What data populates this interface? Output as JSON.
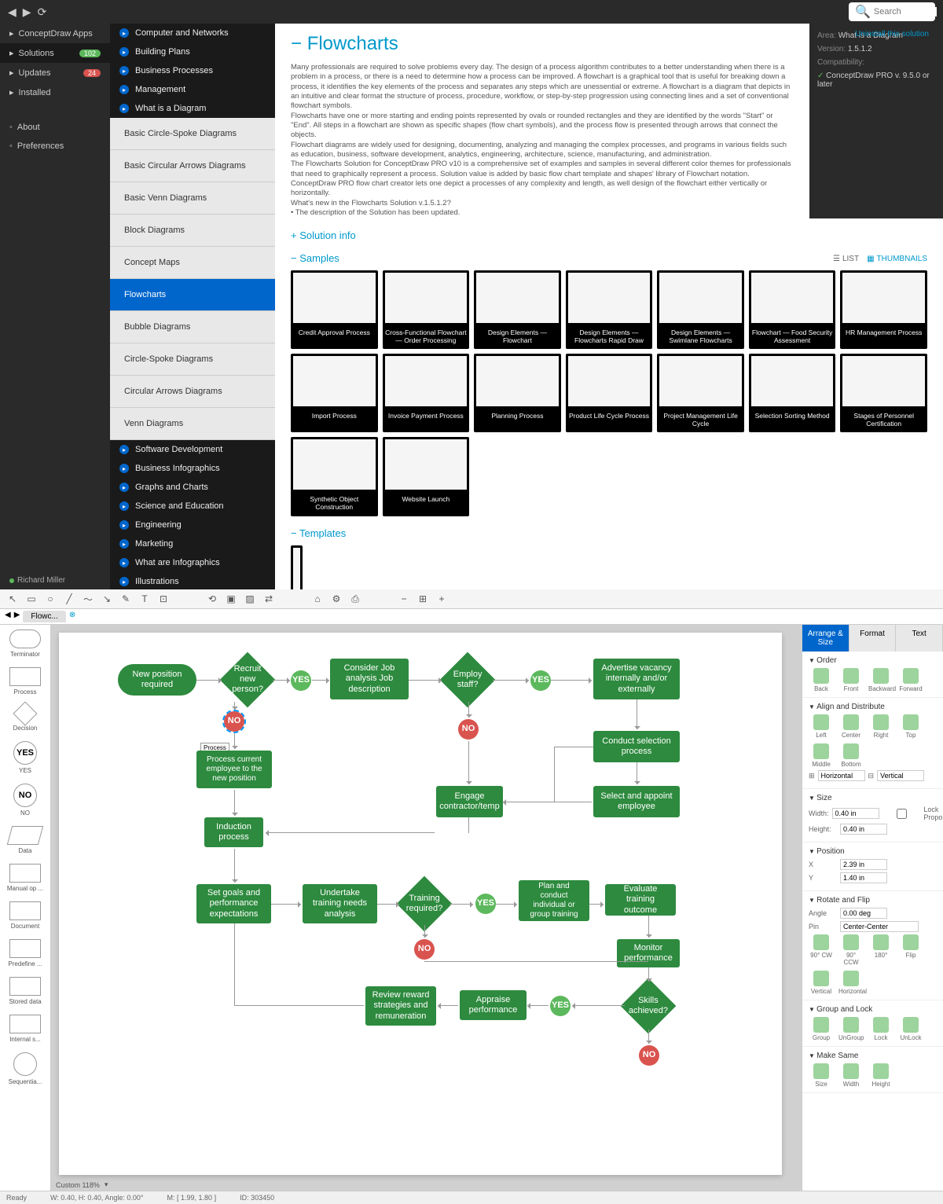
{
  "topbar": {
    "search_placeholder": "Search"
  },
  "leftNav": {
    "items": [
      {
        "label": "ConceptDraw Apps",
        "icon": "apps"
      },
      {
        "label": "Solutions",
        "icon": "cart",
        "badge": "102",
        "badge_color": "green",
        "active": true
      },
      {
        "label": "Updates",
        "icon": "download",
        "badge": "24",
        "badge_color": "red"
      },
      {
        "label": "Installed",
        "icon": "check"
      }
    ],
    "footerItems": [
      {
        "label": "About",
        "icon": "info"
      },
      {
        "label": "Preferences",
        "icon": "gear"
      }
    ],
    "user": "Richard Miller"
  },
  "categories": {
    "top": [
      "Computer and Networks",
      "Building Plans",
      "Business Processes",
      "Management",
      "What is a Diagram"
    ],
    "sub": [
      "Basic Circle-Spoke Diagrams",
      "Basic Circular Arrows Diagrams",
      "Basic Venn Diagrams",
      "Block Diagrams",
      "Concept Maps",
      "Flowcharts",
      "Bubble Diagrams",
      "Circle-Spoke Diagrams",
      "Circular Arrows Diagrams",
      "Venn Diagrams"
    ],
    "selected": "Flowcharts",
    "bottom": [
      "Software Development",
      "Business Infographics",
      "Graphs and Charts",
      "Science and Education",
      "Engineering",
      "Marketing",
      "What are Infographics",
      "Illustrations"
    ]
  },
  "main": {
    "uninstall": "Uninstall this solution",
    "title": "Flowcharts",
    "description": "Many professionals are required to solve problems every day. The design of a process algorithm contributes to a better understanding when there is a problem in a process, or there is a need to determine how a process can be improved. A flowchart is a graphical tool that is useful for breaking down a process, it identifies the key elements of the process and separates any steps which are unessential or extreme. A flowchart is a diagram that depicts in an intuitive and clear format the structure of process, procedure, workflow, or step-by-step progression using connecting lines and a set of conventional flowchart symbols.\nFlowcharts have one or more starting and ending points represented by ovals or rounded rectangles and they are identified by the words \"Start\" or \"End\". All steps in a flowchart are shown as specific shapes (flow chart symbols), and the process flow is presented through arrows that connect the objects.\nFlowchart diagrams are widely used for designing, documenting, analyzing and managing the complex processes, and programs in various fields such as education, business, software development, analytics, engineering, architecture, science, manufacturing, and administration.\nThe Flowcharts Solution for ConceptDraw PRO v10 is a comprehensive set of examples and samples in several different color themes for professionals that need to graphically represent a process. Solution value is added by basic flow chart template and shapes' library of Flowchart notation. ConceptDraw PRO flow chart creator lets one depict a processes of any complexity and length, as well design of the flowchart either vertically or horizontally.\nWhat's new in the Flowcharts Solution v.1.5.1.2?\n  • The description of the Solution has been updated.",
    "meta": {
      "area_label": "Area:",
      "area": "What is a Diagram",
      "version_label": "Version:",
      "version": "1.5.1.2",
      "compat_label": "Compatibility:",
      "compat": "ConceptDraw PRO v. 9.5.0 or later"
    },
    "sections": {
      "info": "Solution info",
      "samples": "Samples",
      "templates": "Templates"
    },
    "view": {
      "list": "LIST",
      "thumb": "THUMBNAILS"
    },
    "samples": [
      "Credit Approval Process",
      "Cross-Functional Flowchart — Order Processing",
      "Design Elements — Flowchart",
      "Design Elements — Flowcharts Rapid Draw",
      "Design Elements — Swimlane Flowcharts",
      "Flowchart — Food Security Assessment",
      "HR Management Process",
      "Import Process",
      "Invoice Payment Process",
      "Planning Process",
      "Product Life Cycle Process",
      "Project Management Life Cycle",
      "Selection Sorting Method",
      "Stages of Personnel Certification",
      "Synthetic Object Construction",
      "Website Launch"
    ]
  },
  "editor": {
    "tab": "Flowc...",
    "palette": [
      {
        "shape": "round",
        "label": "Terminator"
      },
      {
        "shape": "rect",
        "label": "Process"
      },
      {
        "shape": "diamond",
        "label": "Decision"
      },
      {
        "shape": "circle",
        "text": "YES",
        "label": "YES"
      },
      {
        "shape": "circle",
        "text": "NO",
        "label": "NO"
      },
      {
        "shape": "para",
        "label": "Data"
      },
      {
        "shape": "trap",
        "label": "Manual op ..."
      },
      {
        "shape": "doc",
        "label": "Document"
      },
      {
        "shape": "pred",
        "label": "Predefine ..."
      },
      {
        "shape": "stored",
        "label": "Stored data"
      },
      {
        "shape": "intern",
        "label": "Internal s..."
      },
      {
        "shape": "circle",
        "text": "",
        "label": "Sequentia..."
      }
    ],
    "nodes": {
      "n1": "New position required",
      "n2": "Recruit new person?",
      "n3": "Consider Job analysis Job description",
      "n4": "Employ staff?",
      "n5": "Advertise vacancy internally and/or externally",
      "n6": "Process current employee to the new position",
      "n7": "Conduct selection process",
      "n8": "Engage contractor/temp",
      "n9": "Select and appoint employee",
      "n10": "Induction process",
      "n11": "Set goals and performance expectations",
      "n12": "Undertake training needs analysis",
      "n13": "Training required?",
      "n14": "Plan and conduct individual or group training",
      "n15": "Evaluate training outcome",
      "n16": "Monitor performance",
      "n17": "Skills achieved?",
      "n18": "Appraise performance",
      "n19": "Review reward strategies and remuneration",
      "yes": "YES",
      "no": "NO"
    },
    "rightPanel": {
      "tabs": [
        "Arrange & Size",
        "Format",
        "Text"
      ],
      "order": {
        "title": "Order",
        "actions": [
          "Back",
          "Front",
          "Backward",
          "Forward"
        ]
      },
      "align": {
        "title": "Align and Distribute",
        "actions": [
          "Left",
          "Center",
          "Right",
          "Top",
          "Middle",
          "Bottom"
        ],
        "h": "Horizontal",
        "v": "Vertical"
      },
      "size": {
        "title": "Size",
        "width_label": "Width:",
        "width": "0.40 in",
        "height_label": "Height:",
        "height": "0.40 in",
        "lock": "Lock Proportions"
      },
      "position": {
        "title": "Position",
        "x_label": "X",
        "x": "2.39 in",
        "y_label": "Y",
        "y": "1.40 in"
      },
      "rotate": {
        "title": "Rotate and Flip",
        "angle_label": "Angle",
        "angle": "0.00 deg",
        "pin_label": "Pin",
        "pin": "Center-Center",
        "actions": [
          "90° CW",
          "90° CCW",
          "180°",
          "Flip",
          "Vertical",
          "Horizontal"
        ]
      },
      "group": {
        "title": "Group and Lock",
        "actions": [
          "Group",
          "UnGroup",
          "Lock",
          "UnLock"
        ]
      },
      "same": {
        "title": "Make Same",
        "actions": [
          "Size",
          "Width",
          "Height"
        ]
      }
    },
    "zoom": "Custom 118%",
    "status": {
      "ready": "Ready",
      "dims": "W: 0.40, H: 0.40, Angle: 0.00°",
      "mouse": "M: [ 1.99, 1.80 ]",
      "id": "ID: 303450"
    }
  }
}
